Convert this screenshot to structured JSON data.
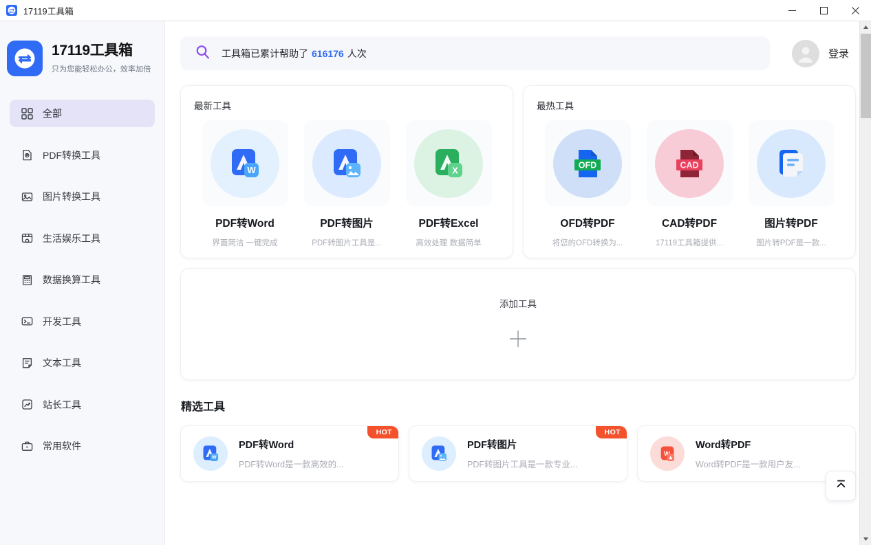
{
  "window": {
    "title": "17119工具箱",
    "app_icon": "swap-arrows-icon",
    "minimize_label": "—",
    "maximize_label": "□",
    "close_label": "✕"
  },
  "brand": {
    "title": "17119工具箱",
    "subtitle": "只为您能轻松办公，效率加倍",
    "logo_color": "#2f6bf5"
  },
  "sidebar": {
    "items": [
      {
        "label": "全部",
        "icon": "grid-icon",
        "active": true
      },
      {
        "label": "PDF转换工具",
        "icon": "pdf-file-icon",
        "active": false
      },
      {
        "label": "图片转换工具",
        "icon": "image-icon",
        "active": false
      },
      {
        "label": "生活娱乐工具",
        "icon": "entertainment-icon",
        "active": false
      },
      {
        "label": "数据换算工具",
        "icon": "calculator-icon",
        "active": false
      },
      {
        "label": "开发工具",
        "icon": "terminal-icon",
        "active": false
      },
      {
        "label": "文本工具",
        "icon": "text-file-icon",
        "active": false
      },
      {
        "label": "站长工具",
        "icon": "chart-icon",
        "active": false
      },
      {
        "label": "常用软件",
        "icon": "briefcase-icon",
        "active": false
      }
    ],
    "active_bg": "#e4e3f8"
  },
  "search": {
    "icon": "search-icon",
    "icon_color": "#8b46f0",
    "prefix_text": "工具箱已累计帮助了",
    "count": "616176",
    "suffix_text": "人次",
    "count_color": "#2f6bf5"
  },
  "account": {
    "avatar_icon": "user-avatar-icon",
    "login_label": "登录"
  },
  "panels": [
    {
      "title": "最新工具",
      "tiles": [
        {
          "name": "PDF转Word",
          "desc": "界面简洁 一键完成",
          "icon": "pdf-to-word-icon",
          "bg": "#e3f0fe"
        },
        {
          "name": "PDF转图片",
          "desc": "PDF转图片工具是...",
          "icon": "pdf-to-image-icon",
          "bg": "#dbeafe"
        },
        {
          "name": "PDF转Excel",
          "desc": "高效处理 数据简单",
          "icon": "pdf-to-excel-icon",
          "bg": "#dcf3e4"
        }
      ]
    },
    {
      "title": "最热工具",
      "tiles": [
        {
          "name": "OFD转PDF",
          "desc": "将您的OFD转换为...",
          "icon": "ofd-to-pdf-icon",
          "bg": "#cedff7"
        },
        {
          "name": "CAD转PDF",
          "desc": "17119工具箱提供...",
          "icon": "cad-to-pdf-icon",
          "bg": "#f8ccd6"
        },
        {
          "name": "图片转PDF",
          "desc": "图片转PDF是一款...",
          "icon": "image-to-pdf-icon",
          "bg": "#d9e9fd"
        }
      ]
    }
  ],
  "add_tool": {
    "label": "添加工具",
    "icon": "plus-icon"
  },
  "featured": {
    "title": "精选工具",
    "cards": [
      {
        "name": "PDF转Word",
        "desc": "PDF转Word是一款高效的...",
        "icon": "pdf-to-word-icon",
        "bg": "#ddeefe",
        "badge": "HOT"
      },
      {
        "name": "PDF转图片",
        "desc": "PDF转图片工具是一款专业...",
        "icon": "pdf-to-image-icon",
        "bg": "#ddeefe",
        "badge": "HOT"
      },
      {
        "name": "Word转PDF",
        "desc": "Word转PDF是一款用户友...",
        "icon": "word-to-pdf-icon",
        "bg": "#fcdcd9",
        "badge": ""
      }
    ],
    "badge_color": "#f4522c"
  },
  "back_to_top": {
    "icon": "scroll-to-top-icon",
    "tooltip": "回到顶部"
  },
  "scrollbar": {
    "up_arrow": "▲",
    "down_arrow": "▼"
  }
}
